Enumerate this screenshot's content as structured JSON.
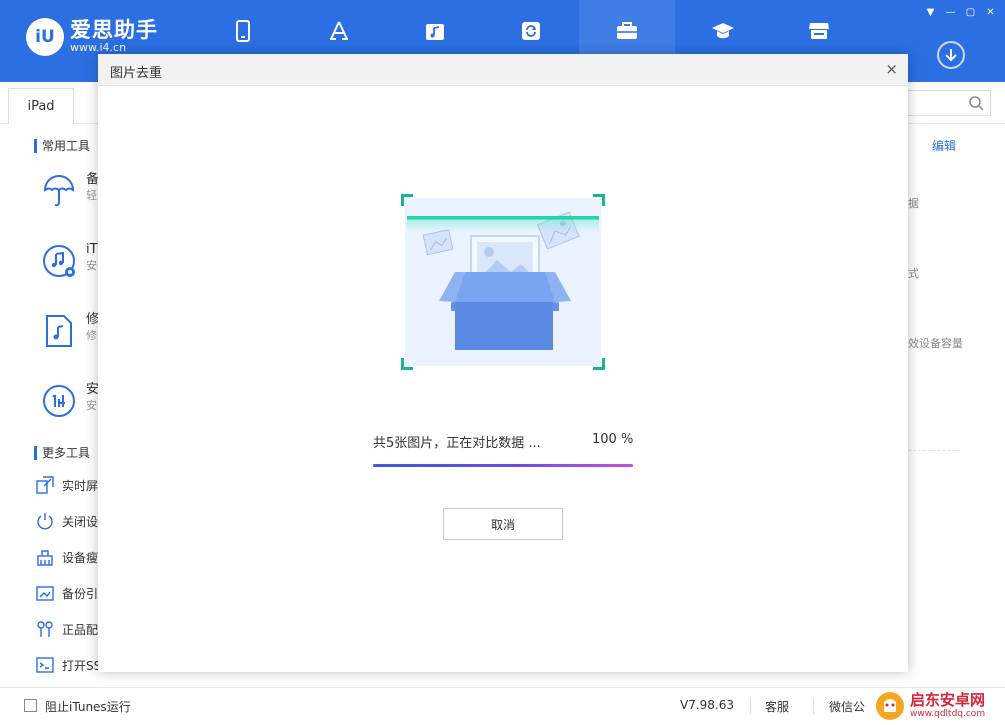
{
  "app": {
    "logo_badge": "iU",
    "logo_name": "爱思助手",
    "logo_url": "www.i4.cn"
  },
  "nav": [
    {
      "name": "device",
      "icon": "phone-icon"
    },
    {
      "name": "apps",
      "icon": "app-store-icon"
    },
    {
      "name": "media",
      "icon": "music-folder-icon"
    },
    {
      "name": "flash",
      "icon": "refresh-icon"
    },
    {
      "name": "toolbox",
      "icon": "toolbox-icon",
      "active": true
    },
    {
      "name": "tutorials",
      "icon": "graduation-cap-icon"
    },
    {
      "name": "store",
      "icon": "store-icon"
    }
  ],
  "window_controls": [
    "▼",
    "—",
    "▢",
    "✕"
  ],
  "device_tab": "iPad",
  "sections": {
    "common": "常用工具",
    "more": "更多工具"
  },
  "tools": [
    {
      "name": "备",
      "desc": "轻"
    },
    {
      "name": "iT",
      "desc": "安"
    },
    {
      "name": "修",
      "desc": "修"
    },
    {
      "name": "安",
      "desc": "安"
    }
  ],
  "more_tools": [
    {
      "label": "实时屏"
    },
    {
      "label": "关闭设"
    },
    {
      "label": "设备瘦"
    },
    {
      "label": "备份引"
    },
    {
      "label": "正品配"
    },
    {
      "label": "打开SS"
    }
  ],
  "right_panel": {
    "edit": "编辑",
    "frag1": "据",
    "frag2": "式",
    "frag3": "效设备容量"
  },
  "modal": {
    "title": "图片去重",
    "close": "×",
    "progress_label": "共5张图片，正在对比数据 ...",
    "progress_pct": "100 %",
    "progress_value": 1.0,
    "cancel": "取消"
  },
  "bottom": {
    "itunes_label": "阻止iTunes运行",
    "version": "V7.98.63",
    "service": "客服",
    "wechat": "微信公"
  },
  "watermark": {
    "name": "启东安卓网",
    "url": "www.qdltdq.com"
  },
  "colors": {
    "brand": "#2b6fe3",
    "scan_green": "#1ab394",
    "watermark_red": "#d9253a"
  }
}
